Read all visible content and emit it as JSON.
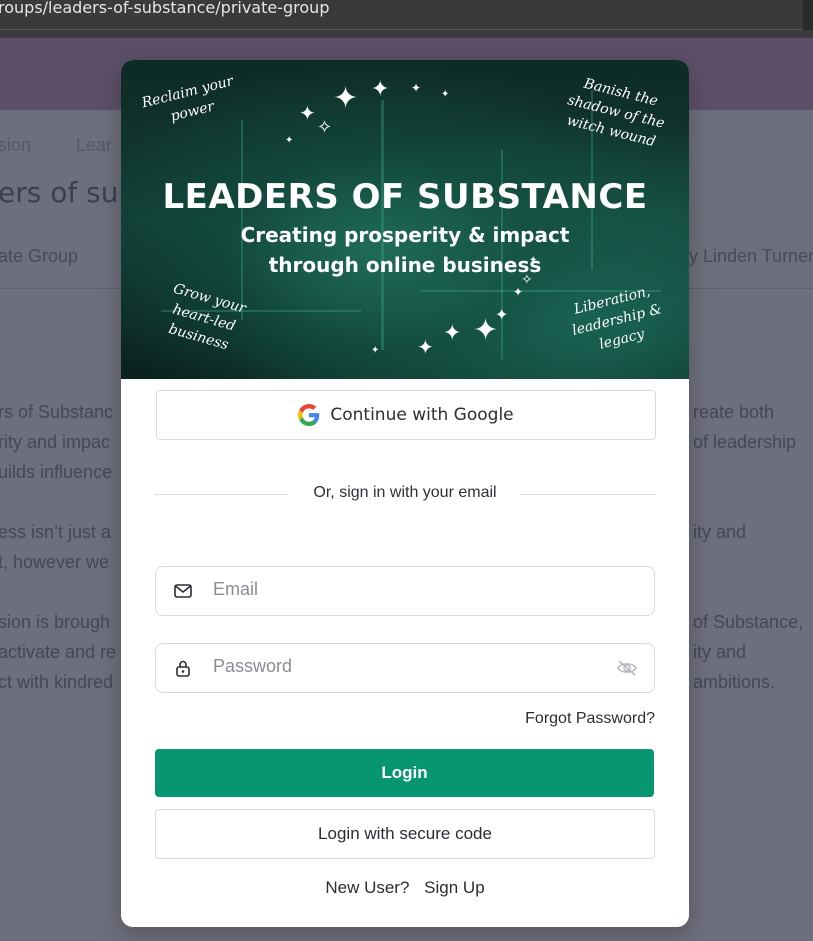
{
  "browser": {
    "url": "roups/leaders-of-substance/private-group"
  },
  "background_page": {
    "nav_items": [
      "sion",
      "Lear"
    ],
    "title_fragment": "ers of su",
    "subtitle_left": "ate Group",
    "subtitle_right": "y Linden Turner",
    "paragraph_left": [
      "rs of Substanc",
      "rity and impac",
      "uilds influence",
      "ess isn’t just a",
      "t, however we",
      "sion is brough",
      "activate and re",
      "ct with kindred"
    ],
    "paragraph_right": [
      "reate both",
      "of leadership",
      "ity and",
      "of Substance,",
      "ity and",
      "ambitions."
    ]
  },
  "banner": {
    "title": "LEADERS OF SUBSTANCE",
    "subtitle": "Creating prosperity & impact through online business",
    "script_top_left": "Reclaim your power",
    "script_top_right": "Banish the shadow of the witch wound",
    "script_bottom_left": "Grow your heart-led business",
    "script_bottom_right": "Liberation, leadership & legacy",
    "colors": {
      "dark": "#0e2b25",
      "accent": "#1f6b58"
    }
  },
  "auth": {
    "google_label": "Continue with Google",
    "divider_text": "Or, sign in with your email",
    "email_placeholder": "Email",
    "password_placeholder": "Password",
    "forgot_label": "Forgot Password?",
    "login_label": "Login",
    "secure_code_label": "Login with secure code",
    "new_user_text": "New User?",
    "signup_label": "Sign Up",
    "colors": {
      "primary": "#079671"
    }
  }
}
